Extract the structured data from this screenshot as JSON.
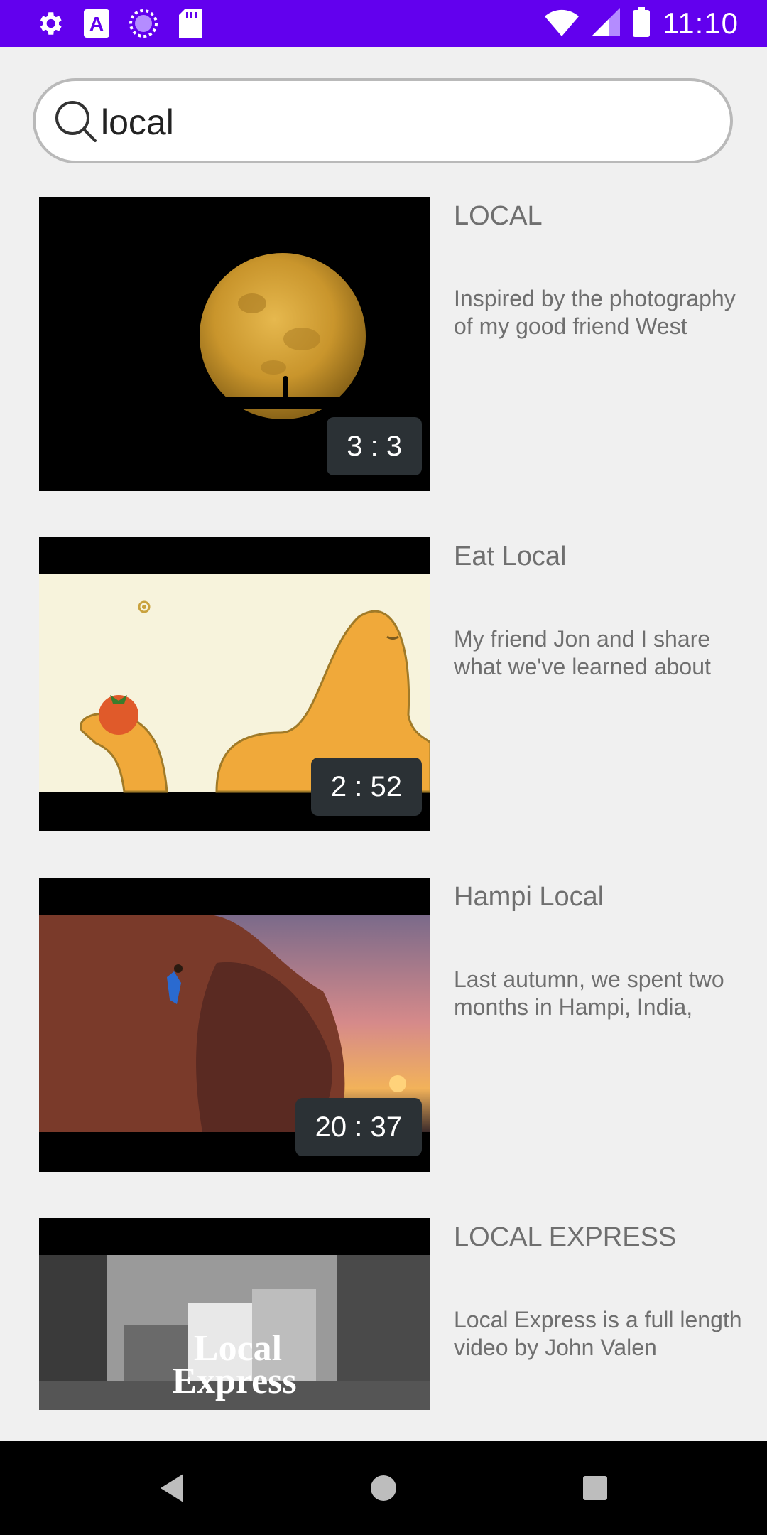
{
  "status_bar": {
    "time": "11:10",
    "left_icons": [
      "gear-icon",
      "font-icon",
      "sync-circle-icon",
      "sd-card-icon"
    ],
    "right_icons": [
      "wifi-icon",
      "signal-icon",
      "battery-icon"
    ],
    "background": "#6200ee"
  },
  "search": {
    "value": "local",
    "placeholder": ""
  },
  "results": [
    {
      "title": "LOCAL",
      "description": "Inspired by the photography of my good friend West",
      "duration": "3 : 3"
    },
    {
      "title": "Eat Local",
      "description": "My friend Jon and I share what we've learned about",
      "duration": "2 : 52"
    },
    {
      "title": "Hampi Local",
      "description": "Last autumn, we spent two months in Hampi, India,",
      "duration": "20 : 37"
    },
    {
      "title": "LOCAL EXPRESS",
      "description": "Local Express is a full length video by John Valen",
      "thumbnail_text_line1": "Local",
      "thumbnail_text_line2": "Express"
    }
  ],
  "navigation": {
    "buttons": [
      "back-icon",
      "home-icon",
      "recents-icon"
    ]
  }
}
